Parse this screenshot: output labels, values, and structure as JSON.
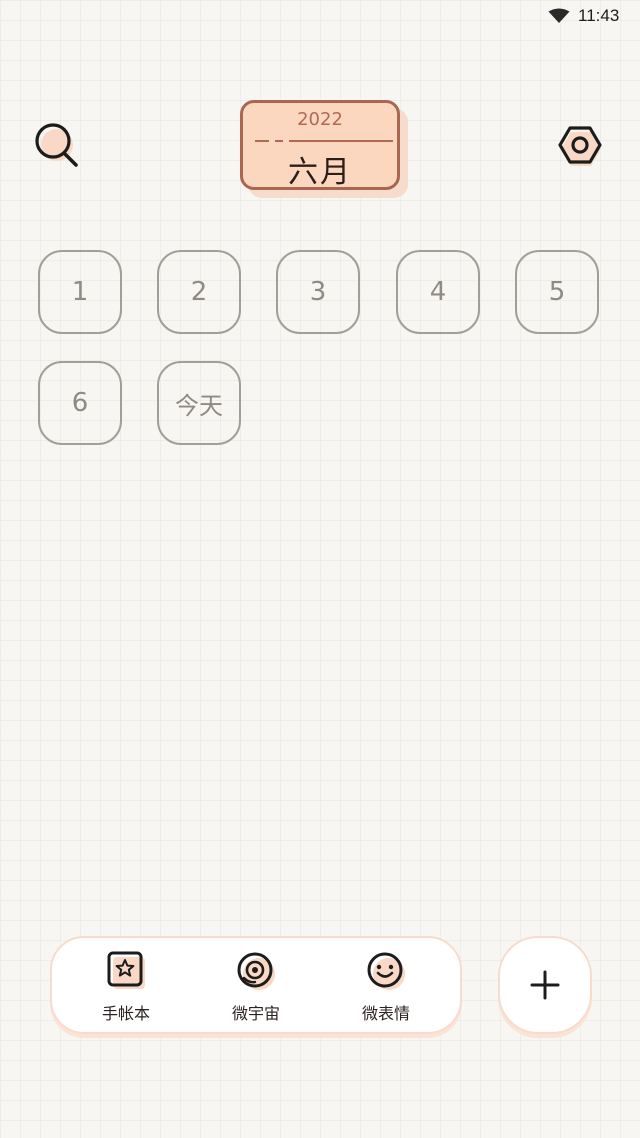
{
  "status_bar": {
    "time": "11:43",
    "wifi_icon": "wifi-icon"
  },
  "header": {
    "search_icon": "search-icon",
    "settings_icon": "settings-icon",
    "year": "2022",
    "month": "六月"
  },
  "days": [
    {
      "label": "1"
    },
    {
      "label": "2"
    },
    {
      "label": "3"
    },
    {
      "label": "4"
    },
    {
      "label": "5"
    },
    {
      "label": "6"
    },
    {
      "label": "今天"
    }
  ],
  "bottom_nav": {
    "items": [
      {
        "label": "手帐本",
        "icon": "journal-icon"
      },
      {
        "label": "微宇宙",
        "icon": "universe-icon"
      },
      {
        "label": "微表情",
        "icon": "smiley-icon"
      }
    ],
    "add_icon": "plus-icon"
  },
  "colors": {
    "accent": "#fbd7c0",
    "accent_border": "#a9674f",
    "tile_border": "#a39e98",
    "background": "#f7f6f2"
  }
}
